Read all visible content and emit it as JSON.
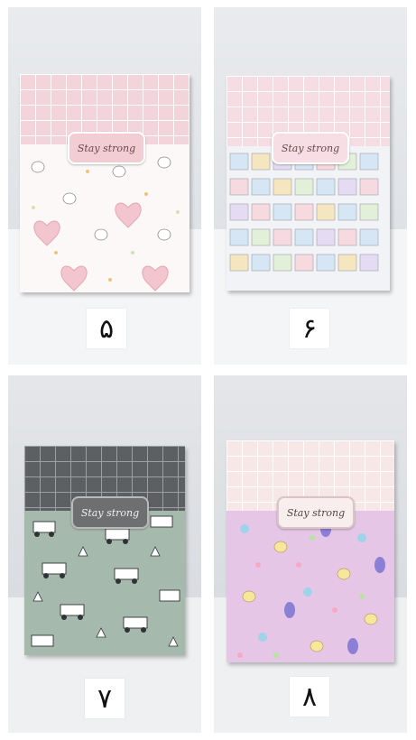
{
  "products": [
    {
      "number_label": "۵",
      "label_text": "Stay strong",
      "pattern_icons": "bunny-hearts-icon"
    },
    {
      "number_label": "۶",
      "label_text": "Stay strong",
      "pattern_icons": "cute-stickers-icon"
    },
    {
      "number_label": "۷",
      "label_text": "Stay strong",
      "pattern_icons": "construction-vehicles-icon"
    },
    {
      "number_label": "۸",
      "label_text": "Stay strong",
      "pattern_icons": "snail-bunny-doodles-icon"
    }
  ],
  "colors": {
    "pink_band": "#f2d4da",
    "blue_band": "#f6dde3",
    "gray_band": "#5d6062",
    "cream_band": "#f7e8e7",
    "mint_pattern": "#a6b9ad",
    "lilac_pattern": "#e5c6e6",
    "white_pattern": "#fbf8f7",
    "sticker_pattern": "#f2f3f6"
  }
}
